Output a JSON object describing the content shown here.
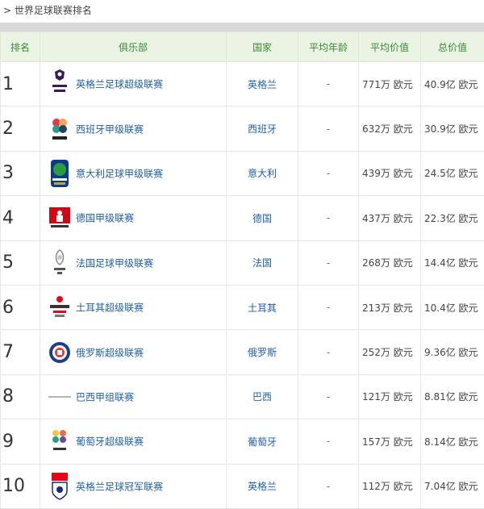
{
  "breadcrumb": {
    "separator": ">",
    "title": "世界足球联赛排名"
  },
  "table": {
    "headers": {
      "rank": "排名",
      "club": "俱乐部",
      "country": "国家",
      "age": "平均年龄",
      "avg_value": "平均价值",
      "total_value": "总价值"
    },
    "rows": [
      {
        "rank": "1",
        "league": "英格兰足球超级联赛",
        "country": "英格兰",
        "age": "-",
        "avg": "771万 欧元",
        "total": "40.9亿 欧元",
        "logo": "premier-league-logo-icon"
      },
      {
        "rank": "2",
        "league": "西班牙甲级联赛",
        "country": "西班牙",
        "age": "-",
        "avg": "632万 欧元",
        "total": "30.9亿 欧元",
        "logo": "laliga-logo-icon"
      },
      {
        "rank": "3",
        "league": "意大利足球甲级联赛",
        "country": "意大利",
        "age": "-",
        "avg": "439万 欧元",
        "total": "24.5亿 欧元",
        "logo": "serie-a-logo-icon"
      },
      {
        "rank": "4",
        "league": "德国甲级联赛",
        "country": "德国",
        "age": "-",
        "avg": "437万 欧元",
        "total": "22.3亿 欧元",
        "logo": "bundesliga-logo-icon"
      },
      {
        "rank": "5",
        "league": "法国足球甲级联赛",
        "country": "法国",
        "age": "-",
        "avg": "268万 欧元",
        "total": "14.4亿 欧元",
        "logo": "ligue1-logo-icon"
      },
      {
        "rank": "6",
        "league": "土耳其超级联赛",
        "country": "土耳其",
        "age": "-",
        "avg": "213万 欧元",
        "total": "10.4亿 欧元",
        "logo": "super-lig-logo-icon"
      },
      {
        "rank": "7",
        "league": "俄罗斯超级联赛",
        "country": "俄罗斯",
        "age": "-",
        "avg": "252万 欧元",
        "total": "9.36亿 欧元",
        "logo": "russian-premier-league-logo-icon"
      },
      {
        "rank": "8",
        "league": "巴西甲组联赛",
        "country": "巴西",
        "age": "-",
        "avg": "121万 欧元",
        "total": "8.81亿 欧元",
        "logo": "brasileirao-logo-icon"
      },
      {
        "rank": "9",
        "league": "葡萄牙超级联赛",
        "country": "葡萄牙",
        "age": "-",
        "avg": "157万 欧元",
        "total": "8.14亿 欧元",
        "logo": "liga-nos-logo-icon"
      },
      {
        "rank": "10",
        "league": "英格兰足球冠军联赛",
        "country": "英格兰",
        "age": "-",
        "avg": "112万 欧元",
        "total": "7.04亿 欧元",
        "logo": "efl-championship-logo-icon"
      }
    ]
  },
  "colors": {
    "header_text": "#3a8a34",
    "header_bg": "#eaf3e4",
    "link": "#1f5fa7",
    "topbar": "#d8d8d8"
  }
}
